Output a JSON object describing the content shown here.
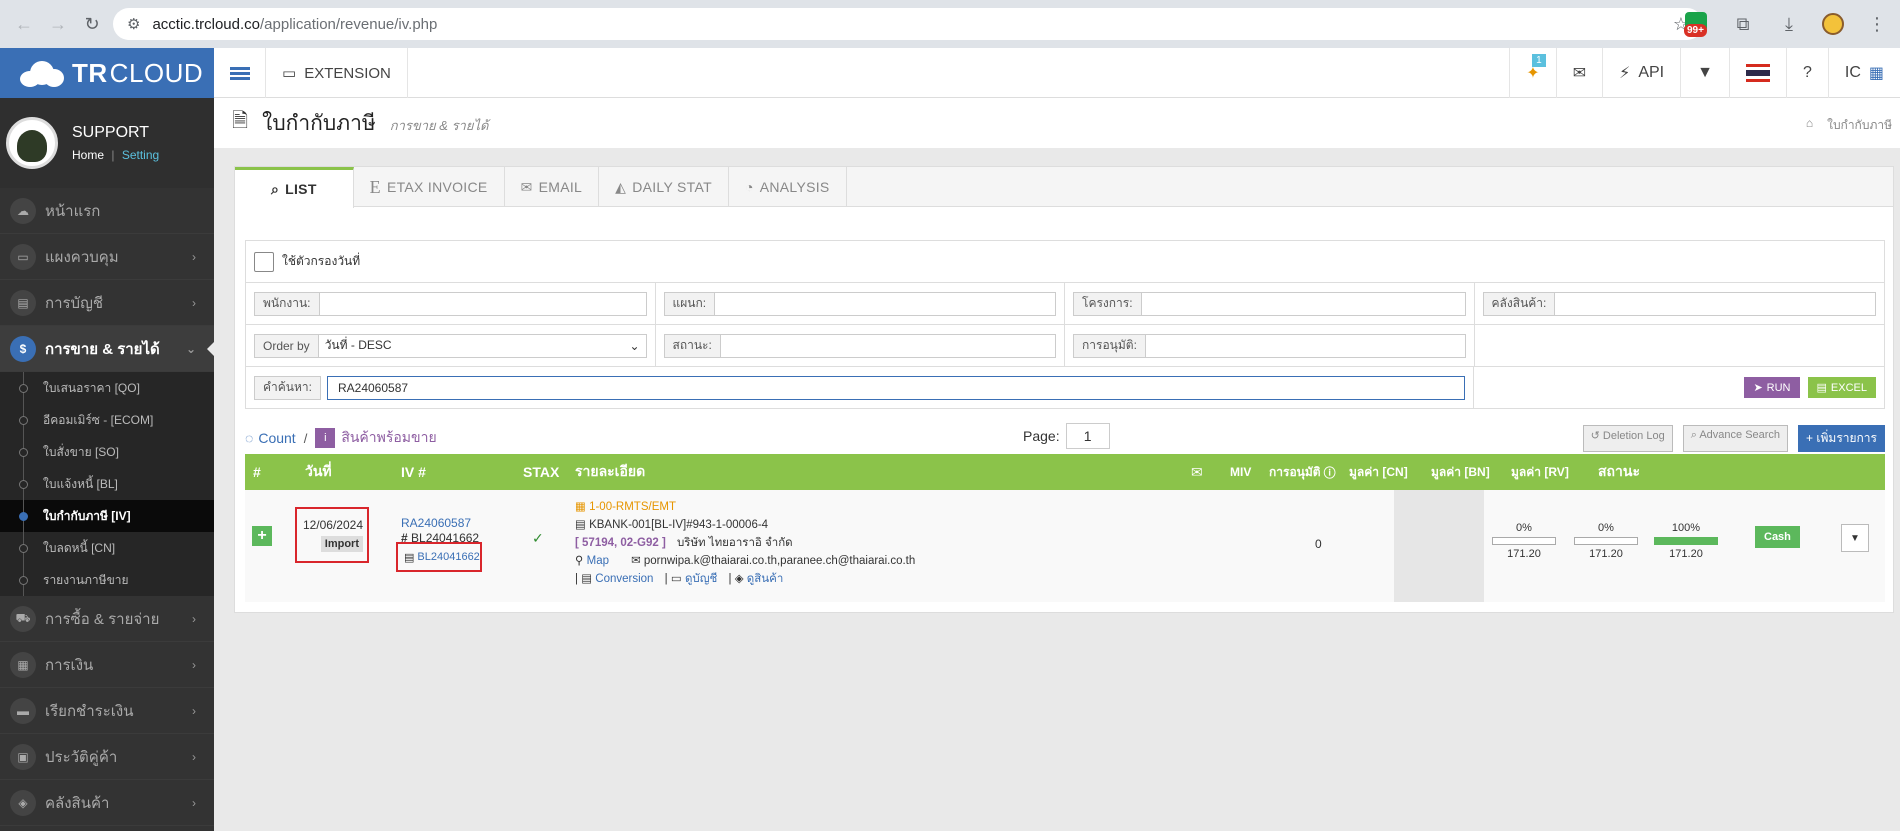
{
  "browser": {
    "url_host": "acctic.trcloud.co",
    "url_path": "/application/revenue/iv.php",
    "ext_count": "99+"
  },
  "brand": {
    "name_bold": "TR",
    "name_light": "CLOUD"
  },
  "topbar": {
    "extension": "EXTENSION",
    "notif_count": "1",
    "api": "API",
    "user": "IC"
  },
  "profile": {
    "name": "SUPPORT",
    "home": "Home",
    "setting": "Setting",
    "sep": "|"
  },
  "menu": [
    {
      "label": "หน้าแรก"
    },
    {
      "label": "แผงควบคุม"
    },
    {
      "label": "การบัญชี"
    },
    {
      "label": "การขาย & รายได้"
    },
    {
      "label": "การซื้อ & รายจ่าย"
    },
    {
      "label": "การเงิน"
    },
    {
      "label": "เรียกชำระเงิน"
    },
    {
      "label": "ประวัติคู่ค้า"
    },
    {
      "label": "คลังสินค้า"
    }
  ],
  "submenu": [
    "ใบเสนอราคา [QO]",
    "อีคอมเมิร์ซ - [ECOM]",
    "ใบสั่งขาย [SO]",
    "ใบแจ้งหนี้ [BL]",
    "ใบกำกับภาษี [IV]",
    "ใบลดหนี้ [CN]",
    "รายงานภาษีขาย"
  ],
  "page": {
    "title": "ใบกำกับภาษี",
    "subtitle": "การขาย & รายได้",
    "crumb": "ใบกำกับภาษี"
  },
  "tabs": [
    "LIST",
    "ETAX INVOICE",
    "EMAIL",
    "DAILY STAT",
    "ANALYSIS"
  ],
  "filters": {
    "date_filter": "ใช้ตัวกรองวันที่",
    "employee": "พนักงาน:",
    "department": "แผนก:",
    "project": "โครงการ:",
    "warehouse": "คลังสินค้า:",
    "order_by": "Order by",
    "order_value": "วันที่ - DESC",
    "status": "สถานะ:",
    "approval": "การอนุมัติ:",
    "search": "คำค้นหา:",
    "search_value": "RA24060587",
    "run": "RUN",
    "excel": "EXCEL"
  },
  "listbar": {
    "count": "Count",
    "slash": "/",
    "stock": "สินค้าพร้อมขาย",
    "page_label": "Page:",
    "page": "1",
    "deletion_log": "Deletion Log",
    "advance_search": "Advance Search",
    "add": "เพิ่มรายการ"
  },
  "grid_headers": {
    "num": "#",
    "date": "วันที่",
    "iv": "IV #",
    "stax": "STAX",
    "detail": "รายละเอียด",
    "miv": "MIV",
    "approve": "การอนุมัติ",
    "cn": "มูลค่า [CN]",
    "bn": "มูลค่า [BN]",
    "rv": "มูลค่า [RV]",
    "status": "สถานะ"
  },
  "row": {
    "date": "12/06/2024",
    "import": "Import",
    "iv_link": "RA24060587",
    "hash": "#",
    "bl": "BL24041662",
    "bl_link": "BL24041662",
    "project": "1-00-RMTS/EMT",
    "bank": "KBANK-001[BL-IV]#943-1-00006-4",
    "code": "[ 57194, 02-G92 ]",
    "company": "บริษัท ไทยอาราอิ จำกัด",
    "map": "Map",
    "emails": "pornwipa.k@thaiarai.co.th,paranee.ch@thaiarai.co.th",
    "sep": "|",
    "conversion": "Conversion",
    "view_acc": "ดูบัญชี",
    "view_prod": "ดูสินค้า",
    "mail_count": "0",
    "cn_pct": "0%",
    "cn_val": "171.20",
    "bn_pct": "0%",
    "bn_val": "171.20",
    "rv_pct": "100%",
    "rv_val": "171.20",
    "status": "Cash"
  },
  "progress": {
    "cn": 0,
    "bn": 0,
    "rv": 100
  },
  "colors": {
    "brand": "#3a6fb5",
    "green": "#8bc34a",
    "purple": "#8e5ea2"
  }
}
